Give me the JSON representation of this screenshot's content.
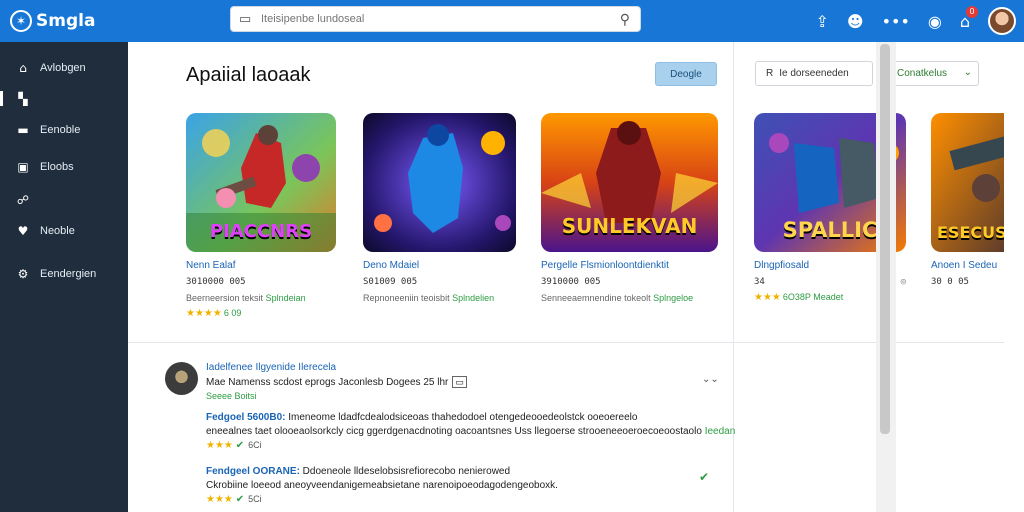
{
  "app": {
    "logo_text": "Smgla"
  },
  "search": {
    "placeholder": "Iteisipenbe lundoseal"
  },
  "topbar": {
    "notification_count": "0"
  },
  "sidebar": {
    "items": [
      {
        "label": "Avlobgen",
        "icon": "home-icon"
      },
      {
        "label": "",
        "icon": "bookmark-icon"
      },
      {
        "label": "Eenoble",
        "icon": "mail-icon"
      },
      {
        "label": "Eloobs",
        "icon": "chat-icon"
      },
      {
        "label": "",
        "icon": "share-icon"
      },
      {
        "label": "Neoble",
        "icon": "heart-icon"
      },
      {
        "label": "Eendergien",
        "icon": "settings-icon"
      }
    ]
  },
  "main": {
    "section_title": "Apaiial laoaak",
    "primary_button": "Deogle",
    "filter_label": "Ie dorseeneden",
    "sort_label": "C Conatkelus",
    "cards": [
      {
        "logo": "PIACCNRS",
        "title": "Nenn Ealaf",
        "meta": "3010000 005",
        "publisher": "Beerneersion teksit",
        "publisher_tag": "Splndeian",
        "stars": "★★★★",
        "rating": "6 09"
      },
      {
        "logo": "",
        "title": "Deno Mdaiel",
        "meta": "S01009 005",
        "publisher": "Repnoneeniin teoisbit",
        "publisher_tag": "Splndelien",
        "stars": "",
        "rating": ""
      },
      {
        "logo": "SUNLEKVAN",
        "title": "Pergelle Flsmionloontdienktit",
        "meta": "3910000 005",
        "publisher": "Senneeaemnendine tokeolt",
        "publisher_tag": "Splngeloe",
        "stars": "",
        "rating": ""
      },
      {
        "logo": "SPALLIC",
        "title": "Dlngpfiosald",
        "meta": "34",
        "publisher": "",
        "publisher_tag": "",
        "stars": "★★★",
        "rating": "6O38P  Meadet"
      },
      {
        "logo": "ESECUS",
        "title": "Anoen I Sedeu",
        "meta": "30 0 05",
        "publisher": "",
        "publisher_tag": "",
        "stars": "",
        "rating": ""
      }
    ]
  },
  "review": {
    "title": "Iadelfenee Ilgyenide Ilerecela",
    "subtitle": "Mae Namenss scdost eprogs Jaconlesb Dogees 25 lhr",
    "green_note": "Seeee Boitsi",
    "lines": [
      {
        "lead": "Fedgoel 5600B0:",
        "text": " Imeneome ldadfcdealodsiceoas thahedodoel otengedeooedeolstck ooeoereelo"
      },
      {
        "lead": "",
        "text": "eneealnes taet olooeaolsorkcly cicg ggerdgenacdnoting oacoantsnes Uss llegoerse strooeneeoeroecoeoostaolo",
        "tag": "Ieedan"
      },
      {
        "lead": "Fendgeel OORANE:",
        "text": " Ddoeneole lldeselobsisrefiorecobo nenierowed"
      },
      {
        "lead": "",
        "text": "Ckrobiine loeeod aneoyveendanigemeabsietane narenoipoeodagodengeoboxk."
      }
    ],
    "stars1": "★★★",
    "stars1_count": "6Ci",
    "stars2": "★★★",
    "stars2_count": "5Ci"
  }
}
